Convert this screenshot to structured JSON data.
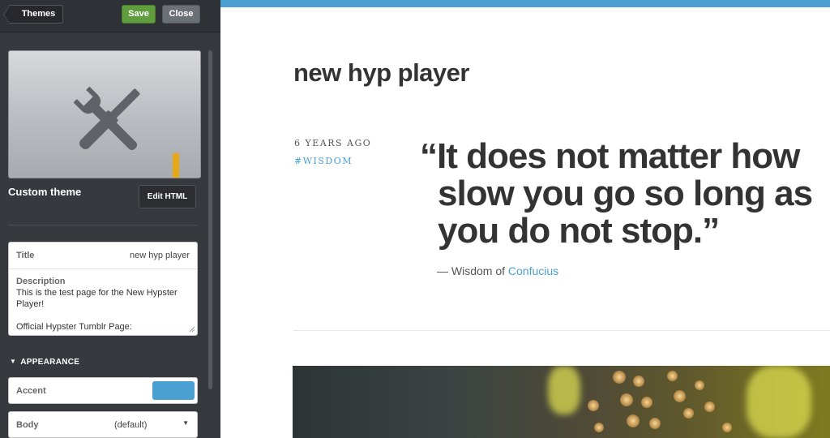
{
  "sidebar": {
    "themes_label": "Themes",
    "save_label": "Save",
    "close_label": "Close",
    "theme_name": "Custom theme",
    "edit_html_label": "Edit HTML",
    "fields": {
      "title_label": "Title",
      "title_value": "new hyp player",
      "description_label": "Description",
      "description_value": "This is the test page for the New Hypster Player!\n\nOfficial Hypster Tumblr Page:"
    },
    "appearance": {
      "header": "APPEARANCE",
      "accent_label": "Accent",
      "accent_color": "#4a9fd3",
      "body_label": "Body",
      "body_value": "(default)"
    }
  },
  "preview": {
    "blog_title": "new hyp player",
    "post": {
      "date": "6 YEARS AGO",
      "tag": "#WISDOM",
      "quote": "“It does not matter how slow you go so long as you do not stop.”",
      "attribution_prefix": "— Wisdom of ",
      "attribution_link": "Confucius"
    }
  },
  "colors": {
    "accent": "#4a9fd3",
    "save_green": "#5f9d3e",
    "sidebar_bg": "#36393e",
    "arrow_yellow": "#e6a817"
  },
  "icons": [
    "chevron-left-icon",
    "tools-icon",
    "down-arrow-icon",
    "caret-down-icon",
    "resize-handle-icon"
  ]
}
